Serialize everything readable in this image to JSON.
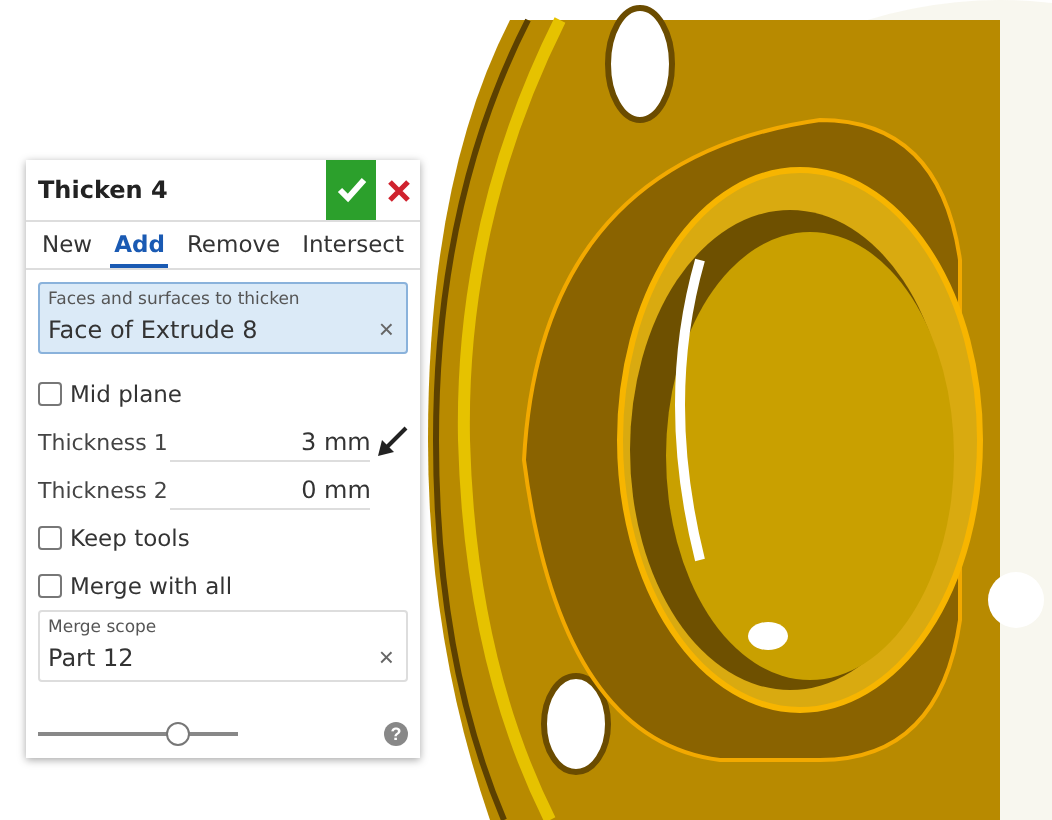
{
  "panel": {
    "title": "Thicken 4",
    "tabs": [
      {
        "label": "New",
        "selected": false
      },
      {
        "label": "Add",
        "selected": true
      },
      {
        "label": "Remove",
        "selected": false
      },
      {
        "label": "Intersect",
        "selected": false
      }
    ],
    "fields": [
      {
        "kind": "selection",
        "label": "Faces and surfaces to thicken",
        "value": "Face of Extrude 8",
        "clear": "×",
        "active": true
      },
      {
        "kind": "checkbox",
        "label": "Mid plane",
        "checked": false
      },
      {
        "kind": "number",
        "label": "Thickness 1",
        "value": "3 mm",
        "flip": true
      },
      {
        "kind": "number",
        "label": "Thickness 2",
        "value": "0 mm",
        "flip": false
      },
      {
        "kind": "checkbox",
        "label": "Keep tools",
        "checked": false
      },
      {
        "kind": "checkbox",
        "label": "Merge with all",
        "checked": false
      },
      {
        "kind": "selection",
        "label": "Merge scope",
        "value": "Part 12",
        "clear": "×",
        "active": false
      }
    ],
    "slider": {
      "level": 0.7
    },
    "help": "?"
  }
}
